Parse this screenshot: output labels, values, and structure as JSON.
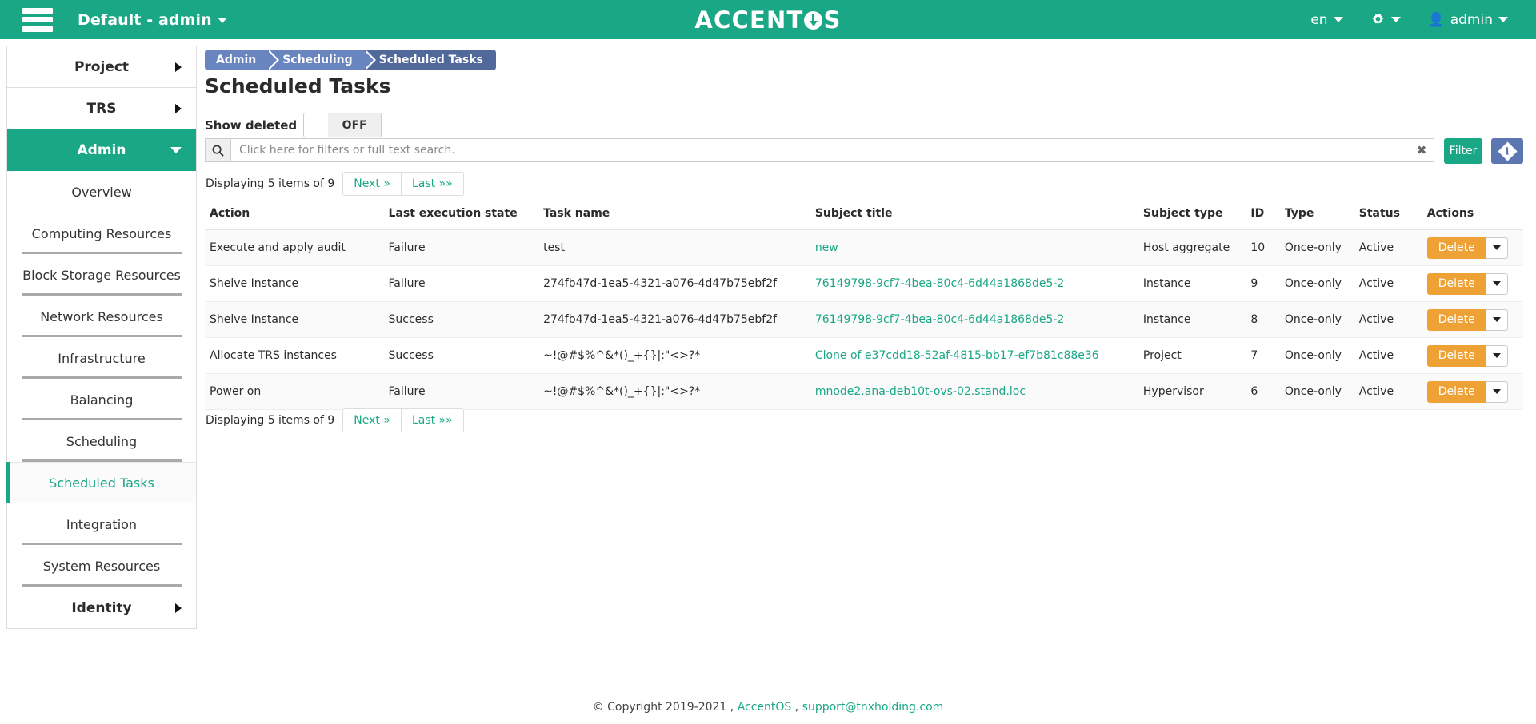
{
  "topbar": {
    "menu_icon": "hamburger-icon",
    "tenant": "Default - admin",
    "brand_prefix": "ACCENT",
    "brand_suffix": "S",
    "language": "en",
    "settings_icon": "gear-icon",
    "user": "admin",
    "accent_color": "#1aa785"
  },
  "sidebar": {
    "groups": [
      {
        "label": "Project",
        "active": false
      },
      {
        "label": "TRS",
        "active": false
      },
      {
        "label": "Admin",
        "active": true
      }
    ],
    "items": [
      {
        "label": "Overview",
        "current": false,
        "separator": false
      },
      {
        "label": "Computing Resources",
        "current": false,
        "separator": true
      },
      {
        "label": "Block Storage Resources",
        "current": false,
        "separator": true
      },
      {
        "label": "Network Resources",
        "current": false,
        "separator": true
      },
      {
        "label": "Infrastructure",
        "current": false,
        "separator": true
      },
      {
        "label": "Balancing",
        "current": false,
        "separator": true
      },
      {
        "label": "Scheduling",
        "current": false,
        "separator": true
      },
      {
        "label": "Scheduled Tasks",
        "current": true,
        "separator": false
      },
      {
        "label": "Integration",
        "current": false,
        "separator": true
      },
      {
        "label": "System Resources",
        "current": false,
        "separator": true
      }
    ],
    "footer_group": {
      "label": "Identity",
      "active": false
    }
  },
  "breadcrumb": [
    {
      "label": "Admin"
    },
    {
      "label": "Scheduling"
    },
    {
      "label": "Scheduled Tasks"
    }
  ],
  "page": {
    "title": "Scheduled Tasks"
  },
  "show_deleted": {
    "label": "Show deleted",
    "state": "OFF"
  },
  "search": {
    "placeholder": "Click here for filters or full text search.",
    "value": "",
    "icon": "search-icon",
    "clear_icon": "close-icon",
    "filter_label": "Filter",
    "info_icon": "info-icon"
  },
  "pagination": {
    "summary": "Displaying 5 items of 9",
    "next_label": "Next »",
    "last_label": "Last »»"
  },
  "table": {
    "columns": [
      "Action",
      "Last execution state",
      "Task name",
      "Subject title",
      "Subject type",
      "ID",
      "Type",
      "Status",
      "Actions"
    ],
    "rows": [
      {
        "action": "Execute and apply audit",
        "state": "Failure",
        "task_name": "test",
        "subject_title": "new",
        "subject_type": "Host aggregate",
        "id": "10",
        "type": "Once-only",
        "status": "Active",
        "action_label": "Delete"
      },
      {
        "action": "Shelve Instance",
        "state": "Failure",
        "task_name": "274fb47d-1ea5-4321-a076-4d47b75ebf2f",
        "subject_title": "76149798-9cf7-4bea-80c4-6d44a1868de5-2",
        "subject_type": "Instance",
        "id": "9",
        "type": "Once-only",
        "status": "Active",
        "action_label": "Delete"
      },
      {
        "action": "Shelve Instance",
        "state": "Success",
        "task_name": "274fb47d-1ea5-4321-a076-4d47b75ebf2f",
        "subject_title": "76149798-9cf7-4bea-80c4-6d44a1868de5-2",
        "subject_type": "Instance",
        "id": "8",
        "type": "Once-only",
        "status": "Active",
        "action_label": "Delete"
      },
      {
        "action": "Allocate TRS instances",
        "state": "Success",
        "task_name": "~!@#$%^&*()_+{}|:\"<>?*",
        "subject_title": "Clone of e37cdd18-52af-4815-bb17-ef7b81c88e36",
        "subject_type": "Project",
        "id": "7",
        "type": "Once-only",
        "status": "Active",
        "action_label": "Delete"
      },
      {
        "action": "Power on",
        "state": "Failure",
        "task_name": "~!@#$%^&*()_+{}|:\"<>?*",
        "subject_title": "mnode2.ana-deb10t-ovs-02.stand.loc",
        "subject_type": "Hypervisor",
        "id": "6",
        "type": "Once-only",
        "status": "Active",
        "action_label": "Delete"
      }
    ]
  },
  "footer": {
    "copyright": "© Copyright 2019-2021 ,",
    "product": "AccentOS",
    "comma": ",",
    "email": "support@tnxholding.com"
  }
}
